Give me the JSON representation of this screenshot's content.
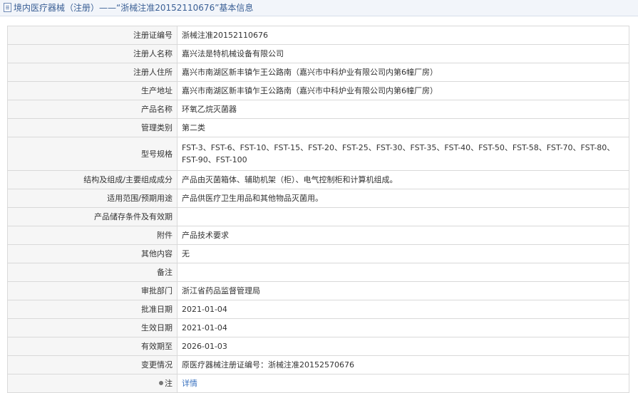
{
  "header": {
    "title": "境内医疗器械（注册）——“浙械注准20152110676”基本信息"
  },
  "rows": [
    {
      "label": "注册证编号",
      "value": "浙械注准20152110676"
    },
    {
      "label": "注册人名称",
      "value": "嘉兴法是特机械设备有限公司"
    },
    {
      "label": "注册人住所",
      "value": "嘉兴市南湖区新丰镇乍王公路南（嘉兴市中科炉业有限公司内第6幢厂房）"
    },
    {
      "label": "生产地址",
      "value": "嘉兴市南湖区新丰镇乍王公路南（嘉兴市中科炉业有限公司内第6幢厂房）"
    },
    {
      "label": "产品名称",
      "value": "环氧乙烷灭菌器"
    },
    {
      "label": "管理类别",
      "value": "第二类"
    },
    {
      "label": "型号规格",
      "value": "FST-3、FST-6、FST-10、FST-15、FST-20、FST-25、FST-30、FST-35、FST-40、FST-50、FST-58、FST-70、FST-80、FST-90、FST-100"
    },
    {
      "label": "结构及组成/主要组成成分",
      "value": "产品由灭菌箱体、辅助机架（柜）、电气控制柜和计算机组成。"
    },
    {
      "label": "适用范围/预期用途",
      "value": "产品供医疗卫生用品和其他物品灭菌用。"
    },
    {
      "label": "产品储存条件及有效期",
      "value": ""
    },
    {
      "label": "附件",
      "value": "产品技术要求"
    },
    {
      "label": "其他内容",
      "value": "无"
    },
    {
      "label": "备注",
      "value": ""
    },
    {
      "label": "审批部门",
      "value": "浙江省药品监督管理局"
    },
    {
      "label": "批准日期",
      "value": "2021-01-04"
    },
    {
      "label": "生效日期",
      "value": "2021-01-04"
    },
    {
      "label": "有效期至",
      "value": "2026-01-03"
    },
    {
      "label": "变更情况",
      "value": "原医疗器械注册证编号：浙械注准20152570676"
    },
    {
      "label": "注",
      "value": "详情"
    }
  ]
}
